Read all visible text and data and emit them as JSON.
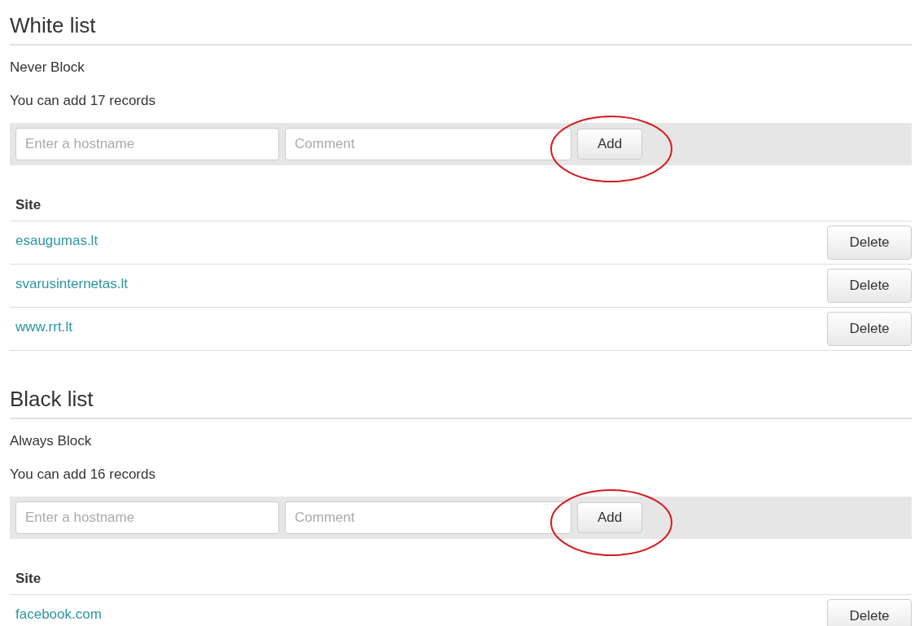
{
  "sections": [
    {
      "title": "White list",
      "subtitle": "Never Block",
      "quota": "You can add 17 records",
      "form": {
        "hostname": {
          "placeholder": "Enter a hostname"
        },
        "comment": {
          "placeholder": "Comment"
        },
        "button": "Add",
        "circled": true
      },
      "table": {
        "column": "Site",
        "rows": [
          {
            "site": "esaugumas.lt",
            "button": "Delete"
          },
          {
            "site": "svarusinternetas.lt",
            "button": "Delete"
          },
          {
            "site": "www.rrt.lt",
            "button": "Delete"
          }
        ]
      }
    },
    {
      "title": "Black list",
      "subtitle": "Always Block",
      "quota": "You can add 16 records",
      "form": {
        "hostname": {
          "placeholder": "Enter a hostname"
        },
        "comment": {
          "placeholder": "Comment"
        },
        "button": "Add",
        "circled": true
      },
      "table": {
        "column": "Site",
        "rows": [
          {
            "site": "facebook.com",
            "button": "Delete"
          }
        ]
      }
    }
  ]
}
